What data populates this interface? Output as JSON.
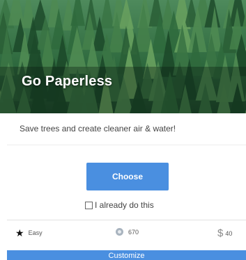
{
  "hero": {
    "title": "Go Paperless",
    "image_icon": "forest-image"
  },
  "description": "Save trees and create cleaner air & water!",
  "choose_button": {
    "label": "Choose"
  },
  "already_do_this": {
    "label": "I already do this",
    "checked": false
  },
  "stats": {
    "difficulty": {
      "icon": "star-icon",
      "label": "Easy"
    },
    "points": {
      "icon": "points-icon",
      "value": "670"
    },
    "savings": {
      "icon": "dollar-icon",
      "symbol": "$",
      "value": "40"
    }
  },
  "customize_button": {
    "label": "Customize"
  },
  "colors": {
    "accent": "#4a8fe0",
    "forest_dark": "#1f4a2c",
    "forest_light": "#6aa36b"
  }
}
